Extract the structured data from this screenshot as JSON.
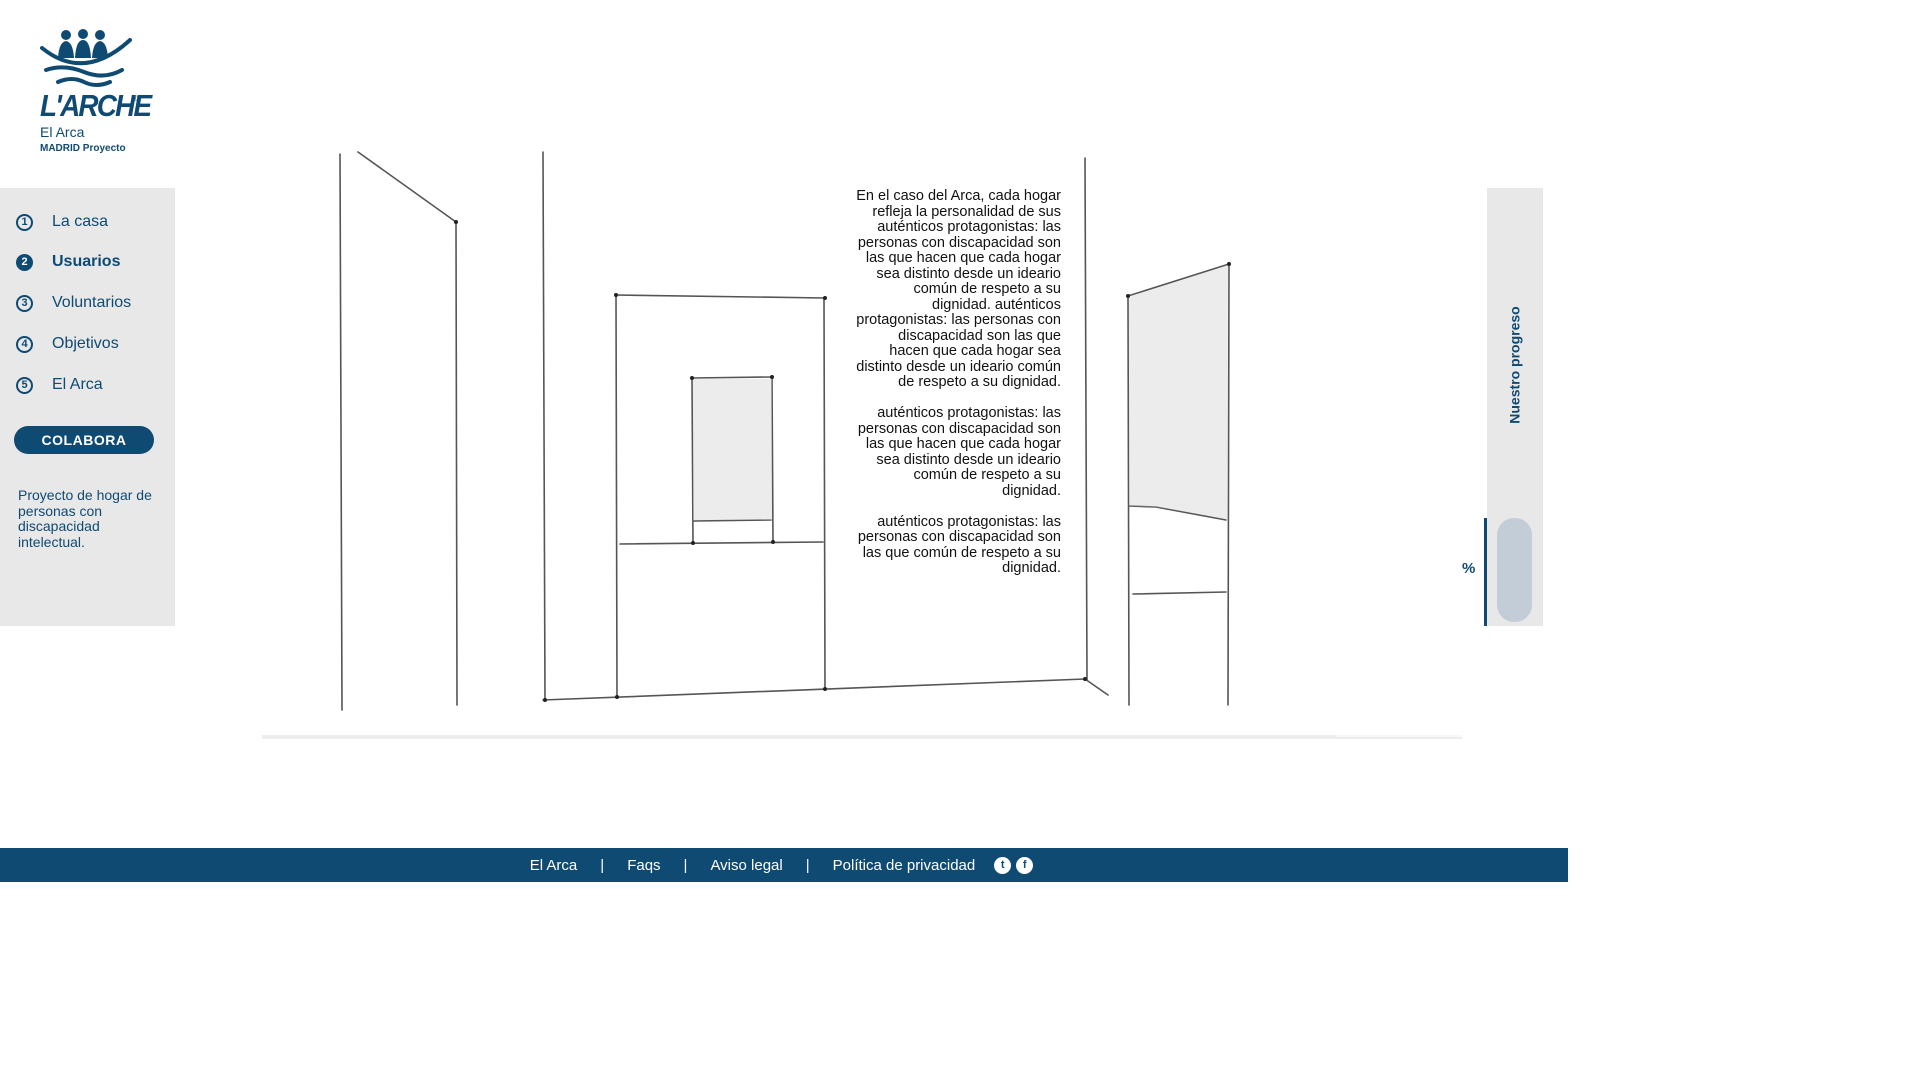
{
  "brand": {
    "name": "L'ARCHE",
    "registered": "®",
    "subtitle": "El Arca",
    "tagline": "MADRID Proyecto",
    "color": "#0f4a73"
  },
  "nav": {
    "items": [
      {
        "num": "1",
        "label": "La casa"
      },
      {
        "num": "2",
        "label": "Usuarios"
      },
      {
        "num": "3",
        "label": "Voluntarios"
      },
      {
        "num": "4",
        "label": "Objetivos"
      },
      {
        "num": "5",
        "label": "El Arca"
      }
    ],
    "active": "Usuarios"
  },
  "cta": {
    "label": "COLABORA"
  },
  "sidebar_text": "Proyecto de hogar de personas con discapacidad intelectual.",
  "story": {
    "paragraphs": [
      "En el caso del Arca, cada hogar refleja la personalidad de sus auténticos protagonistas: las personas con discapacidad son las que hacen que cada hogar sea distinto desde un ideario común de respeto a su dignidad. auténticos protagonistas: las personas con discapacidad son las que hacen que cada hogar sea distinto desde un ideario común de respeto a su dignidad.",
      "auténticos protagonistas: las personas con discapacidad son las que hacen que cada hogar sea distinto desde un ideario común de respeto a su dignidad.",
      "auténticos protagonistas: las personas con discapacidad son las que común de respeto a su dignidad."
    ]
  },
  "progress": {
    "title": "Nuestro progreso",
    "percent_symbol": "%"
  },
  "footer": {
    "links": [
      "El Arca",
      "Faqs",
      "Aviso legal",
      "Política de privacidad"
    ],
    "separator": "|",
    "social": [
      {
        "icon": "twitter-icon",
        "glyph": "t"
      },
      {
        "icon": "facebook-icon",
        "glyph": "f"
      }
    ]
  }
}
